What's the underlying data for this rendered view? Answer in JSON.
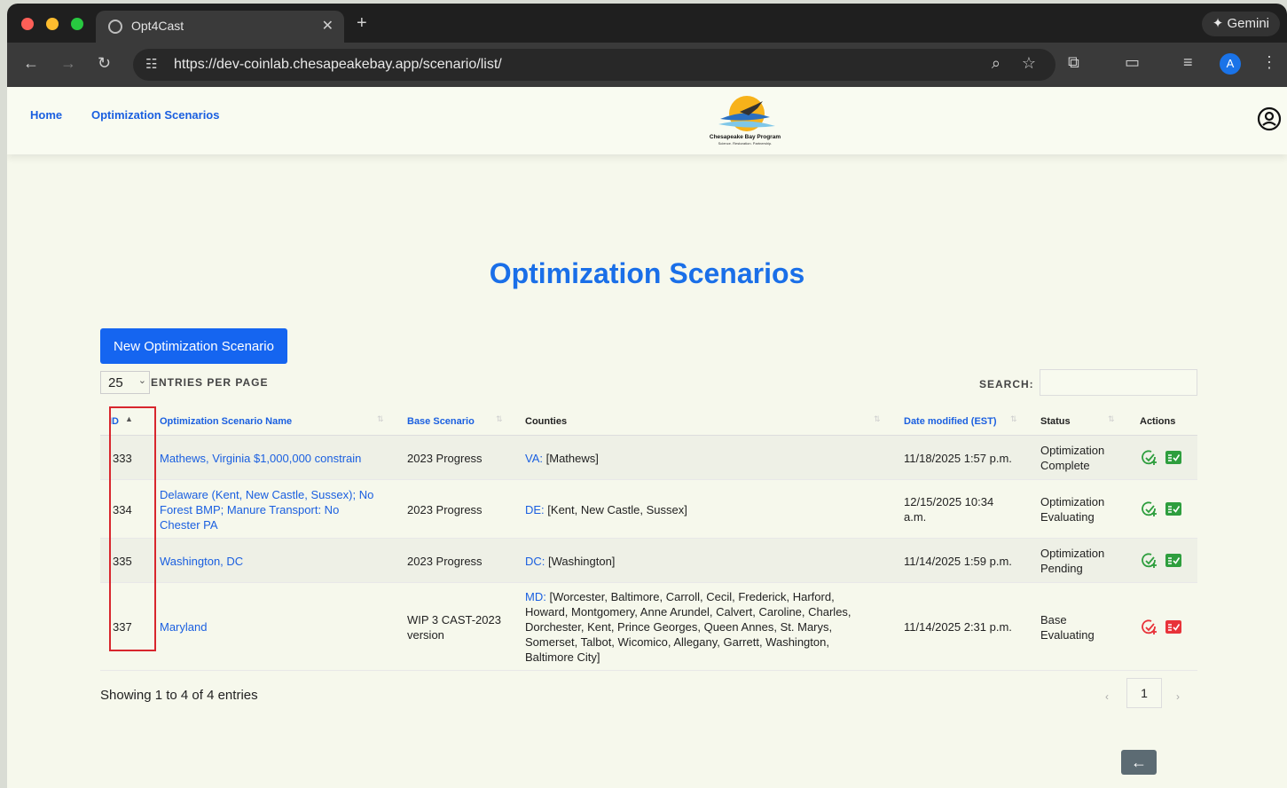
{
  "browser": {
    "tab_title": "Opt4Cast",
    "tab_close": "✕",
    "new_tab": "+",
    "gemini_label": "✦ Gemini",
    "url": "https://dev-coinlab.chesapeakebay.app/scenario/list/",
    "profile_initial": "A"
  },
  "nav": {
    "home": "Home",
    "scenarios": "Optimization Scenarios"
  },
  "page": {
    "title": "Optimization Scenarios",
    "new_button": "New Optimization Scenario",
    "entries_value": "25",
    "entries_label": "ENTRIES PER PAGE",
    "search_label": "SEARCH:",
    "search_value": ""
  },
  "table": {
    "headers": {
      "id": "ID",
      "name": "Optimization Scenario Name",
      "base": "Base Scenario",
      "counties": "Counties",
      "date": "Date modified (EST)",
      "status": "Status",
      "actions": "Actions"
    },
    "rows": [
      {
        "id": "333",
        "name": [
          "Mathews, Virginia $1,000,000 constrain"
        ],
        "base": [
          "2023 Progress"
        ],
        "state": "VA:",
        "counties": [
          "[Mathews]"
        ],
        "date": [
          "11/18/2025 1:57 p.m."
        ],
        "status": [
          "Optimization",
          "Complete"
        ],
        "action_color": "#2e9e3e"
      },
      {
        "id": "334",
        "name": [
          "Delaware (Kent, New Castle, Sussex); No",
          "Forest BMP; Manure Transport: No",
          "Chester PA"
        ],
        "base": [
          "2023 Progress"
        ],
        "state": "DE:",
        "counties": [
          "[Kent, New Castle, Sussex]"
        ],
        "date": [
          "12/15/2025 10:34",
          "a.m."
        ],
        "status": [
          "Optimization",
          "Evaluating"
        ],
        "action_color": "#2e9e3e"
      },
      {
        "id": "335",
        "name": [
          "Washington, DC"
        ],
        "base": [
          "2023 Progress"
        ],
        "state": "DC:",
        "counties": [
          "[Washington]"
        ],
        "date": [
          "11/14/2025 1:59 p.m."
        ],
        "status": [
          "Optimization",
          "Pending"
        ],
        "action_color": "#2e9e3e"
      },
      {
        "id": "337",
        "name": [
          "Maryland"
        ],
        "base": [
          "WIP 3 CAST-2023",
          "version"
        ],
        "state": "MD:",
        "counties": [
          "[Worcester, Baltimore, Carroll, Cecil, Frederick, Harford,",
          "Howard, Montgomery, Anne Arundel, Calvert, Caroline, Charles,",
          "Dorchester, Kent, Prince Georges, Queen Annes, St. Marys,",
          "Somerset, Talbot, Wicomico, Allegany, Garrett, Washington,",
          "Baltimore City]"
        ],
        "date": [
          "11/14/2025 2:31 p.m."
        ],
        "status": [
          "Base",
          "Evaluating"
        ],
        "action_color": "#e8333a"
      }
    ]
  },
  "footer": {
    "showing": "Showing 1 to 4 of 4 entries",
    "page_prev": "‹",
    "page_current": "1",
    "page_next": "›",
    "back_arrow": "←"
  },
  "logo": {
    "line1": "Chesapeake Bay Program",
    "line2": "Science. Restoration. Partnership."
  }
}
